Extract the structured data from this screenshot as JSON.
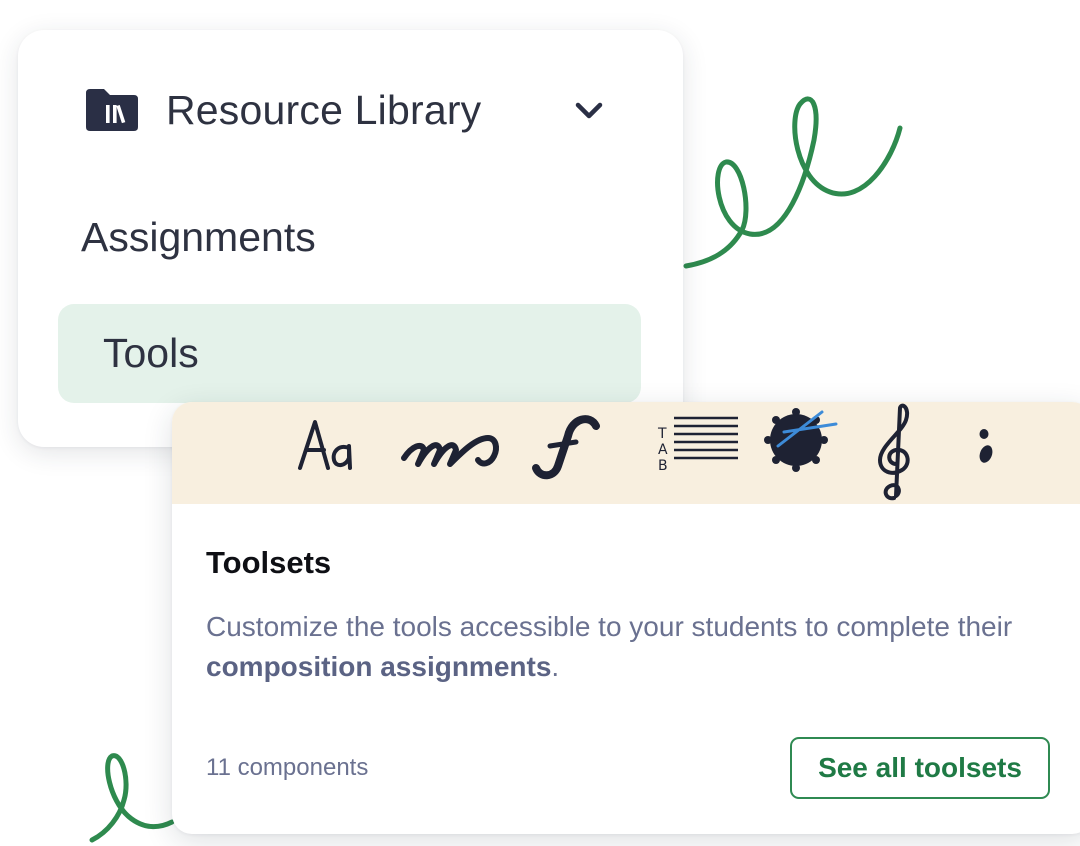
{
  "nav": {
    "header_label": "Resource Library",
    "header_icon": "folder-library-icon",
    "items": [
      {
        "label": "Assignments",
        "active": false
      },
      {
        "label": "Tools",
        "active": true
      }
    ]
  },
  "toolset_card": {
    "title": "Toolsets",
    "description_plain": "Customize the tools accessible to your students to complete their ",
    "description_bold": "composition assignments",
    "description_end": ".",
    "count": "11 components",
    "cta_label": "See all toolsets",
    "banner_icons": [
      "text-aa-icon",
      "dynamics-mf-icon",
      "forte-f-icon",
      "tab-staff-icon",
      "drum-icon",
      "treble-clef-icon",
      "fermata-dots-icon"
    ]
  },
  "colors": {
    "accent_green": "#1f7a45",
    "active_item_bg": "#e4f2ea",
    "banner_bg": "#f8efdf",
    "doodle_green": "#2e8a4e",
    "text_dark": "#2e3241",
    "text_muted": "#6a7190"
  }
}
